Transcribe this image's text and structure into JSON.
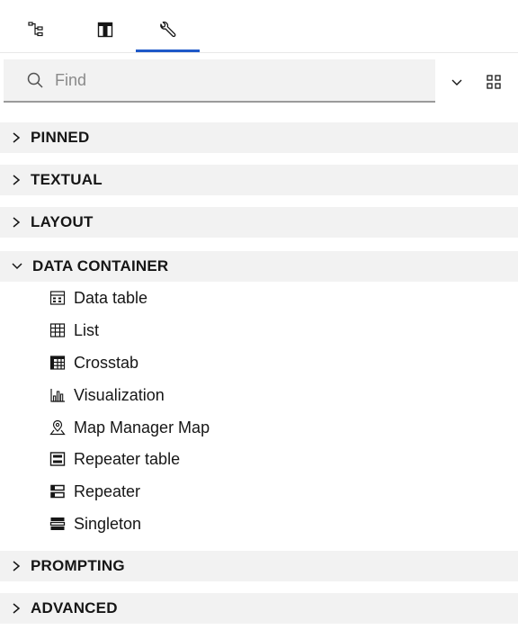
{
  "tabs": [
    {
      "name": "tree-icon"
    },
    {
      "name": "layout-icon"
    },
    {
      "name": "wrench-icon",
      "selected": true
    }
  ],
  "search": {
    "placeholder": "Find",
    "value": ""
  },
  "toolbar": {
    "options_icon": "chevron-down-icon",
    "view_icon": "grid-view-icon"
  },
  "categories": [
    {
      "label": "PINNED",
      "expanded": false
    },
    {
      "label": "TEXTUAL",
      "expanded": false
    },
    {
      "label": "LAYOUT",
      "expanded": false
    },
    {
      "label": "DATA CONTAINER",
      "expanded": true
    },
    {
      "label": "PROMPTING",
      "expanded": false
    },
    {
      "label": "ADVANCED",
      "expanded": false
    }
  ],
  "data_container_items": [
    {
      "label": "Data table",
      "icon": "data-table-icon"
    },
    {
      "label": "List",
      "icon": "list-icon"
    },
    {
      "label": "Crosstab",
      "icon": "crosstab-icon"
    },
    {
      "label": "Visualization",
      "icon": "visualization-icon"
    },
    {
      "label": "Map Manager Map",
      "icon": "map-pin-icon"
    },
    {
      "label": "Repeater table",
      "icon": "repeater-table-icon"
    },
    {
      "label": "Repeater",
      "icon": "repeater-icon"
    },
    {
      "label": "Singleton",
      "icon": "singleton-icon"
    }
  ],
  "colors": {
    "accent": "#1f59c8",
    "header_bg": "#f2f2f2",
    "text": "#161616"
  }
}
